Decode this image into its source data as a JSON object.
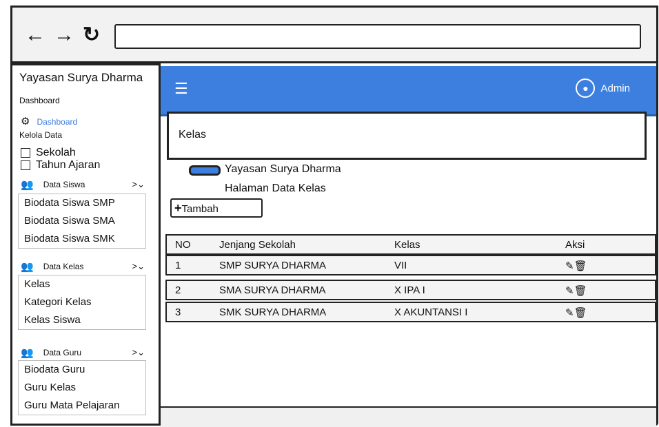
{
  "browser": {
    "back_icon": "arrow-left-icon",
    "forward_icon": "arrow-right-icon",
    "reload_icon": "reload-icon",
    "url": ""
  },
  "sidebar": {
    "brand": "Yayasan Surya Dharma",
    "section_dashboard": "Dashboard",
    "dashboard_link": "Dashboard",
    "section_kelola": "Kelola Data",
    "checks": [
      "Sekolah",
      "Tahun Ajaran"
    ],
    "groups": [
      {
        "title": "Data Siswa",
        "items": [
          "Biodata Siswa SMP",
          "Biodata Siswa SMA",
          "Biodata Siswa SMK"
        ]
      },
      {
        "title": "Data Kelas",
        "items": [
          "Kelas",
          "Kategori Kelas",
          "Kelas Siswa"
        ]
      },
      {
        "title": "Data Guru",
        "items": [
          "Biodata Guru",
          "Guru Kelas",
          "Guru Mata Pelajaran"
        ]
      }
    ]
  },
  "topbar": {
    "menu_icon": "hamburger-icon",
    "user": "Admin"
  },
  "page": {
    "title": "Kelas",
    "breadcrumb1": "Yayasan Surya Dharma",
    "breadcrumb2": "Halaman Data Kelas",
    "add_label": "Tambah"
  },
  "table": {
    "headers": [
      "NO",
      "Jenjang Sekolah",
      "Kelas",
      "Aksi"
    ],
    "rows": [
      {
        "no": "1",
        "jenjang": "SMP SURYA DHARMA",
        "kelas": "VII"
      },
      {
        "no": "2",
        "jenjang": "SMA SURYA DHARMA",
        "kelas": "X IPA I"
      },
      {
        "no": "3",
        "jenjang": "SMK SURYA DHARMA",
        "kelas": "X AKUNTANSI I"
      }
    ]
  },
  "colors": {
    "accent": "#3c7fdf",
    "link": "#3b7be0"
  }
}
